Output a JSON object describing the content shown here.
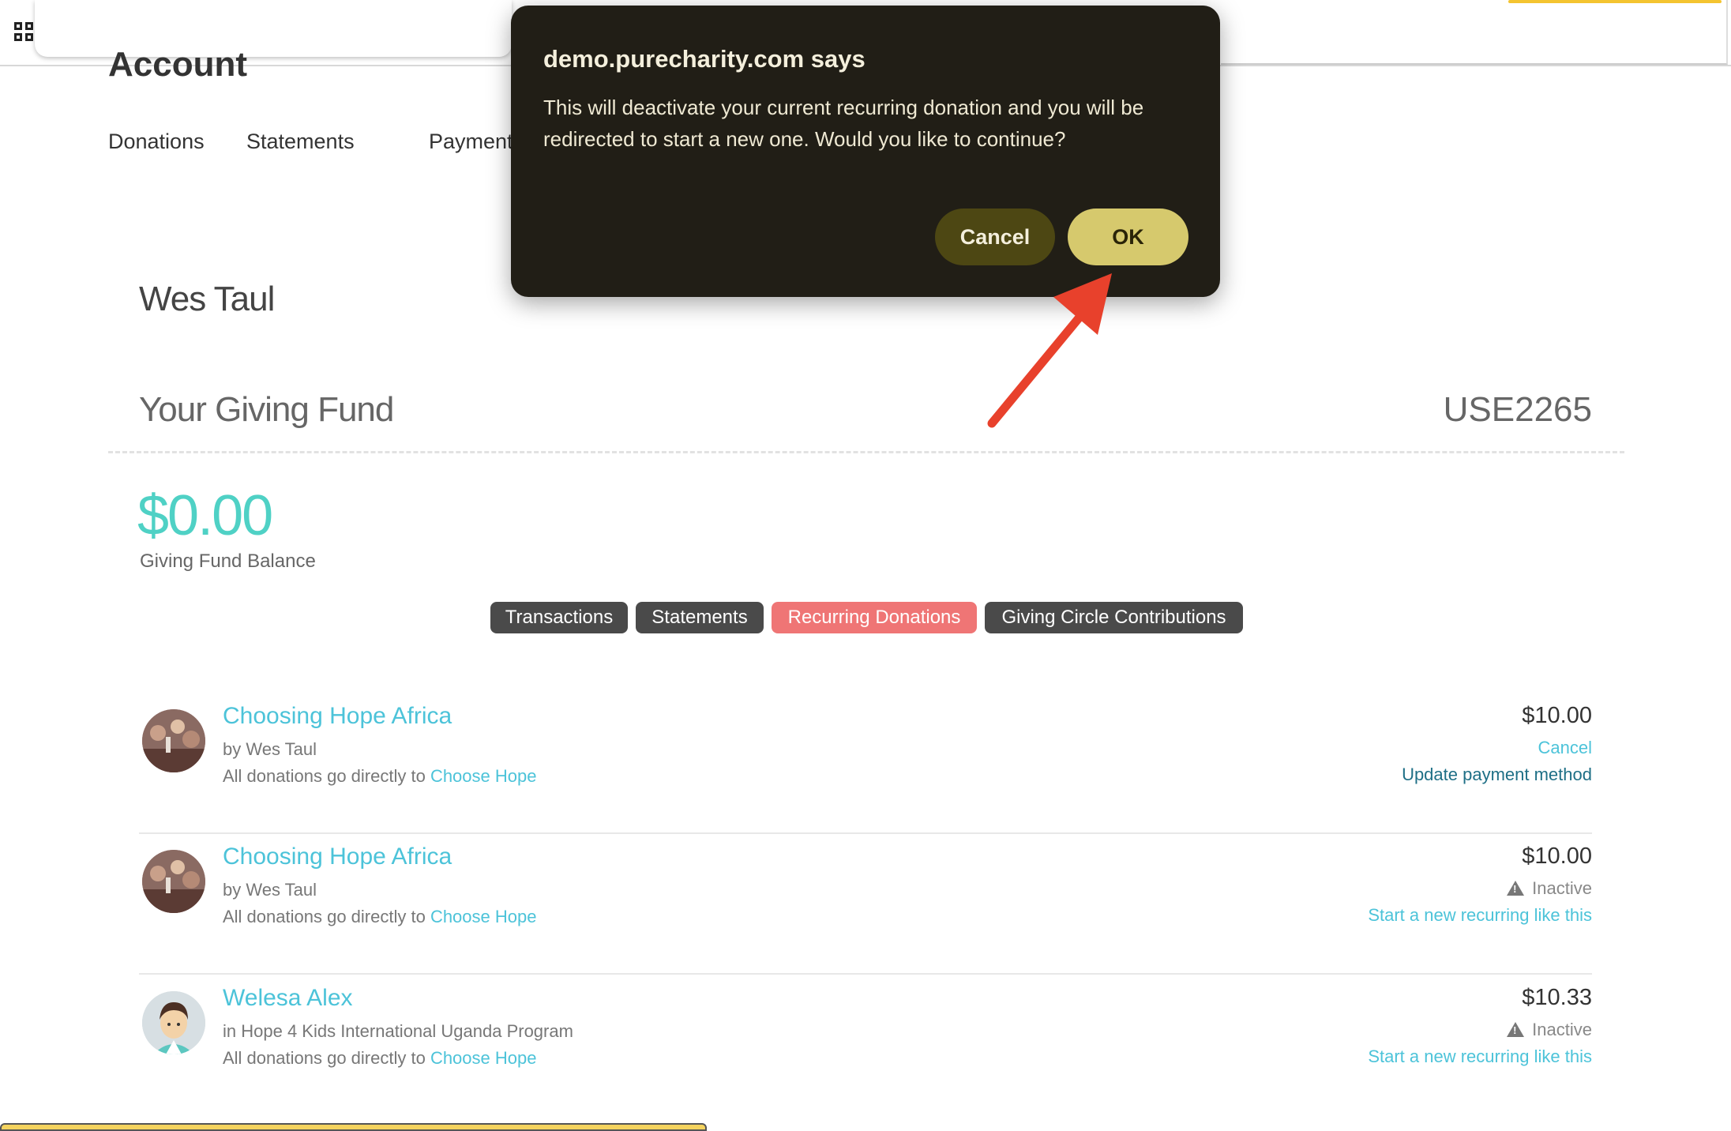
{
  "page": {
    "title": "Account",
    "nav": [
      "Donations",
      "Statements",
      "Payment"
    ]
  },
  "account": {
    "name": "Wes Taul",
    "fund_label": "Your Giving Fund",
    "fund_id": "USE2265",
    "balance": "$0.00",
    "balance_label": "Giving Fund Balance"
  },
  "tabs": [
    {
      "label": "Transactions",
      "active": false
    },
    {
      "label": "Statements",
      "active": false
    },
    {
      "label": "Recurring Donations",
      "active": true
    },
    {
      "label": "Giving Circle Contributions",
      "active": false
    }
  ],
  "donations": [
    {
      "title": "Choosing Hope Africa",
      "subtitle": "by Wes Taul",
      "note_prefix": "All donations go directly to ",
      "note_link": "Choose Hope",
      "amount": "$10.00",
      "status": "Cancel",
      "action": "Update payment method"
    },
    {
      "title": "Choosing Hope Africa",
      "subtitle": "by Wes Taul",
      "note_prefix": "All donations go directly to ",
      "note_link": "Choose Hope",
      "amount": "$10.00",
      "status": "Inactive",
      "action": "Start a new recurring like this"
    },
    {
      "title": "Welesa Alex",
      "subtitle": "in Hope 4 Kids International Uganda Program",
      "note_prefix": "All donations go directly to ",
      "note_link": "Choose Hope",
      "amount": "$10.33",
      "status": "Inactive",
      "action": "Start a new recurring like this"
    }
  ],
  "dialog": {
    "title": "demo.purecharity.com says",
    "message": "This will deactivate your current recurring donation and you will be redirected to start a new one. Would you like to continue?",
    "cancel_label": "Cancel",
    "ok_label": "OK"
  },
  "colors": {
    "accent_link": "#4cc3d9",
    "balance": "#4fd1c5",
    "active_tab": "#ef7575",
    "dialog_bg": "#211e16",
    "ok_button": "#d6c96d",
    "annotation_arrow": "#e8412c"
  }
}
